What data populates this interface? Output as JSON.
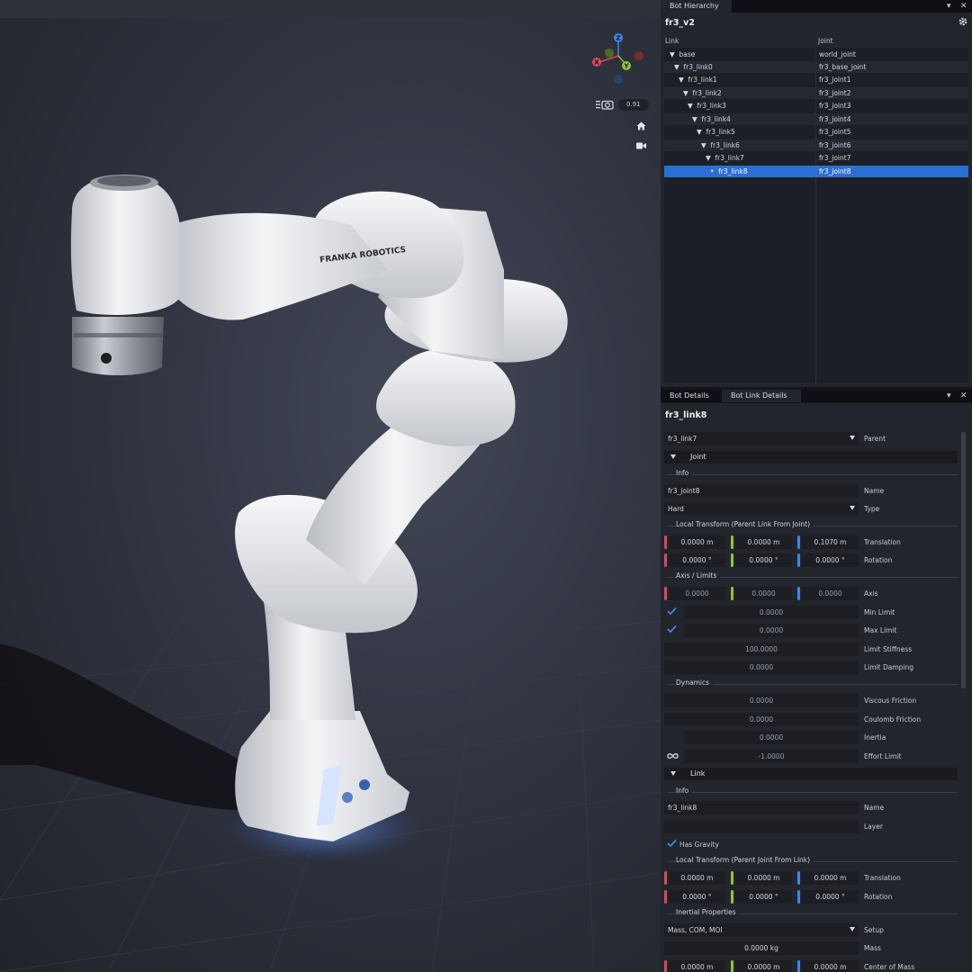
{
  "viewport": {
    "robot_brand": "FRANKA ROBOTICS",
    "camera_speed": "0.91",
    "gizmo_axes": {
      "x": "X",
      "y": "Y",
      "z": "Z",
      "x_color": "#d9485a",
      "y_color": "#8fc23a",
      "z_color": "#3f86e6"
    },
    "icons": {
      "camera": "camera-speed-icon",
      "home": "home-icon",
      "video": "video-camera-icon"
    }
  },
  "hierarchy": {
    "tab": "Bot Hierarchy",
    "title": "fr3_v2",
    "columns": {
      "link": "Link",
      "joint": "Joint"
    },
    "rows": [
      {
        "link": "base",
        "joint": "world_joint"
      },
      {
        "link": "fr3_link0",
        "joint": "fr3_base_joint"
      },
      {
        "link": "fr3_link1",
        "joint": "fr3_joint1"
      },
      {
        "link": "fr3_link2",
        "joint": "fr3_joint2"
      },
      {
        "link": "fr3_link3",
        "joint": "fr3_joint3"
      },
      {
        "link": "fr3_link4",
        "joint": "fr3_joint4"
      },
      {
        "link": "fr3_link5",
        "joint": "fr3_joint5"
      },
      {
        "link": "fr3_link6",
        "joint": "fr3_joint6"
      },
      {
        "link": "fr3_link7",
        "joint": "fr3_joint7"
      },
      {
        "link": "fr3_link8",
        "joint": "fr3_joint8"
      }
    ],
    "selected": "fr3_link8"
  },
  "details": {
    "tabs": [
      "Bot Details",
      "Bot Link Details"
    ],
    "active_tab": "Bot Link Details",
    "title": "fr3_link8",
    "parent": {
      "value": "fr3_link7",
      "label": "Parent"
    },
    "joint_section": "Joint",
    "joint": {
      "info_label": "Info",
      "name": {
        "value": "fr3_joint8",
        "label": "Name"
      },
      "type": {
        "value": "Hard",
        "label": "Type"
      },
      "transform_label": "Local Transform (Parent Link From Joint)",
      "translation": {
        "x": "0.0000 m",
        "y": "0.0000 m",
        "z": "0.1070 m",
        "label": "Translation"
      },
      "rotation": {
        "x": "0.0000 °",
        "y": "0.0000 °",
        "z": "0.0000 °",
        "label": "Rotation"
      },
      "axis_label": "Axis / Limits",
      "axis": {
        "x": "0.0000",
        "y": "0.0000",
        "z": "0.0000",
        "label": "Axis"
      },
      "min_limit": {
        "value": "0.0000",
        "label": "Min Limit"
      },
      "max_limit": {
        "value": "0.0000",
        "label": "Max Limit"
      },
      "limit_stiffness": {
        "value": "100.0000",
        "label": "Limit Stiffness"
      },
      "limit_damping": {
        "value": "0.0000",
        "label": "Limit Damping"
      },
      "dynamics_label": "Dynamics",
      "viscous_friction": {
        "value": "0.0000",
        "label": "Viscous Friction"
      },
      "coulomb_friction": {
        "value": "0.0000",
        "label": "Coulomb Friction"
      },
      "inertia": {
        "value": "0.0000",
        "label": "Inertia"
      },
      "effort_limit": {
        "value": "-1.0000",
        "label": "Effort Limit"
      }
    },
    "link_section": "Link",
    "link": {
      "info_label": "Info",
      "name": {
        "value": "fr3_link8",
        "label": "Name"
      },
      "layer": {
        "value": "",
        "label": "Layer"
      },
      "has_gravity": "Has Gravity",
      "transform_label": "Local Transform (Parent Joint From Link)",
      "translation": {
        "x": "0.0000 m",
        "y": "0.0000 m",
        "z": "0.0000 m",
        "label": "Translation"
      },
      "rotation": {
        "x": "0.0000 °",
        "y": "0.0000 °",
        "z": "0.0000 °",
        "label": "Rotation"
      },
      "inertial_label": "Inertial Properties",
      "setup": {
        "value": "Mass, COM, MOI",
        "label": "Setup"
      },
      "mass": {
        "value": "0.0000 kg",
        "label": "Mass"
      },
      "com": {
        "x": "0.0000 m",
        "y": "0.0000 m",
        "z": "0.0000 m",
        "label": "Center of Mass"
      }
    }
  }
}
